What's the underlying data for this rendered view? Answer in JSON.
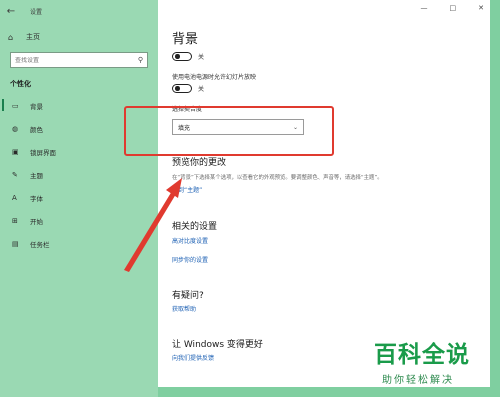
{
  "window": {
    "app_title": "设置",
    "controls": [
      "—",
      "□",
      "✕"
    ]
  },
  "sidebar": {
    "home_label": "主页",
    "search_placeholder": "查找设置",
    "section_label": "个性化",
    "items": [
      {
        "label": "背景",
        "icon": "image-icon"
      },
      {
        "label": "颜色",
        "icon": "palette-icon"
      },
      {
        "label": "锁屏界面",
        "icon": "lock-screen-icon"
      },
      {
        "label": "主题",
        "icon": "brush-icon"
      },
      {
        "label": "字体",
        "icon": "font-icon"
      },
      {
        "label": "开始",
        "icon": "start-icon"
      },
      {
        "label": "任务栏",
        "icon": "taskbar-icon"
      }
    ]
  },
  "main": {
    "title": "背景",
    "toggle1_state": "关",
    "battery_option_label": "使用电池电源时允许幻灯片放映",
    "toggle2_state": "关",
    "fit_label": "选择契合度",
    "fit_value": "填充",
    "preview_heading": "预览你的更改",
    "preview_desc": "在“背景”下选择某个选项，以查看它的外观预览。要调整颜色、声音等，请选择“主题”。",
    "themes_link": "转到“主题”",
    "related_heading": "相关的设置",
    "related_links": [
      "高对比度设置",
      "同步你的设置"
    ],
    "help_heading": "有疑问?",
    "help_link": "获取帮助",
    "better_heading": "让 Windows 变得更好",
    "feedback_link": "向我们提供反馈"
  },
  "watermark": {
    "main": "百科全说",
    "sub": "助你轻松解决"
  },
  "colors": {
    "frame": "#7fcfa0",
    "sidebar": "#9ad9b3",
    "highlight": "#e03a2f",
    "link": "#1b5fb3",
    "watermark": "#1a9b4a"
  }
}
